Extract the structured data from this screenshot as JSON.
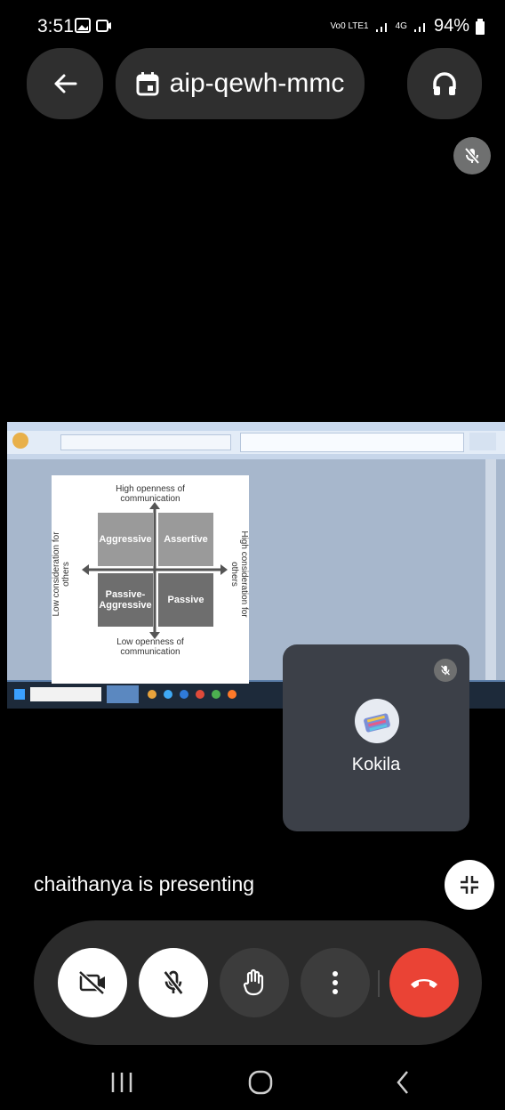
{
  "status_bar": {
    "time": "3:51",
    "network_labels": [
      "Vo0 LTE1",
      "4G"
    ],
    "battery": "94%"
  },
  "top_bar": {
    "meeting_code": "aip-qewh-mmc"
  },
  "shared_screen": {
    "diagram": {
      "top_label": "High openness of communication",
      "bottom_label": "Low openness of communication",
      "left_label": "Low consideration for others",
      "right_label": "High consideration for others",
      "quadrants": [
        "Aggressive",
        "Assertive",
        "Passive-Aggressive",
        "Passive"
      ]
    }
  },
  "participant": {
    "name": "Kokila"
  },
  "presenting_text": "chaithanya is presenting",
  "controls": {
    "camera_icon": "camera-off-icon",
    "mic_icon": "mic-off-icon",
    "hand_icon": "raise-hand-icon",
    "more_icon": "more-vert-icon",
    "end_icon": "end-call-icon"
  },
  "colors": {
    "end_call": "#ea4335",
    "pill_bg": "#2f2f2f",
    "tile_bg": "#3c4048"
  }
}
